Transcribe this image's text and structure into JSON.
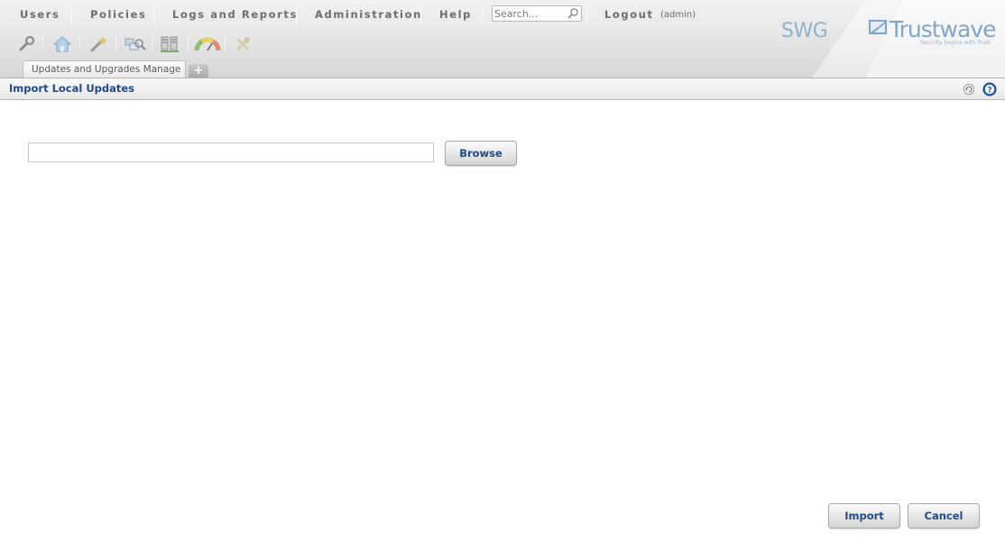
{
  "menu": {
    "items": [
      "Users",
      "Policies",
      "Logs and Reports",
      "Administration",
      "Help"
    ],
    "logout": "Logout",
    "user": "(admin)"
  },
  "search": {
    "placeholder": "Search..."
  },
  "toolbar": {
    "icons": [
      "wrench-icon",
      "home-icon",
      "wand-icon",
      "network-search-icon",
      "servers-icon",
      "dashboard-gauge-icon",
      "tools-disabled-icon"
    ]
  },
  "brand": {
    "product": "SWG",
    "company": "Trustwave",
    "tagline": "Security begins with Trust",
    "accent": "#7fa6c7"
  },
  "tabs": {
    "active_label": "Updates and Upgrades Manage",
    "add_label": "+"
  },
  "page": {
    "title": "Import Local Updates"
  },
  "form": {
    "file_value": "",
    "browse_label": "Browse",
    "import_label": "Import",
    "cancel_label": "Cancel"
  },
  "colors": {
    "title_text": "#1f4a82",
    "menu_text": "#6c6c6c"
  }
}
